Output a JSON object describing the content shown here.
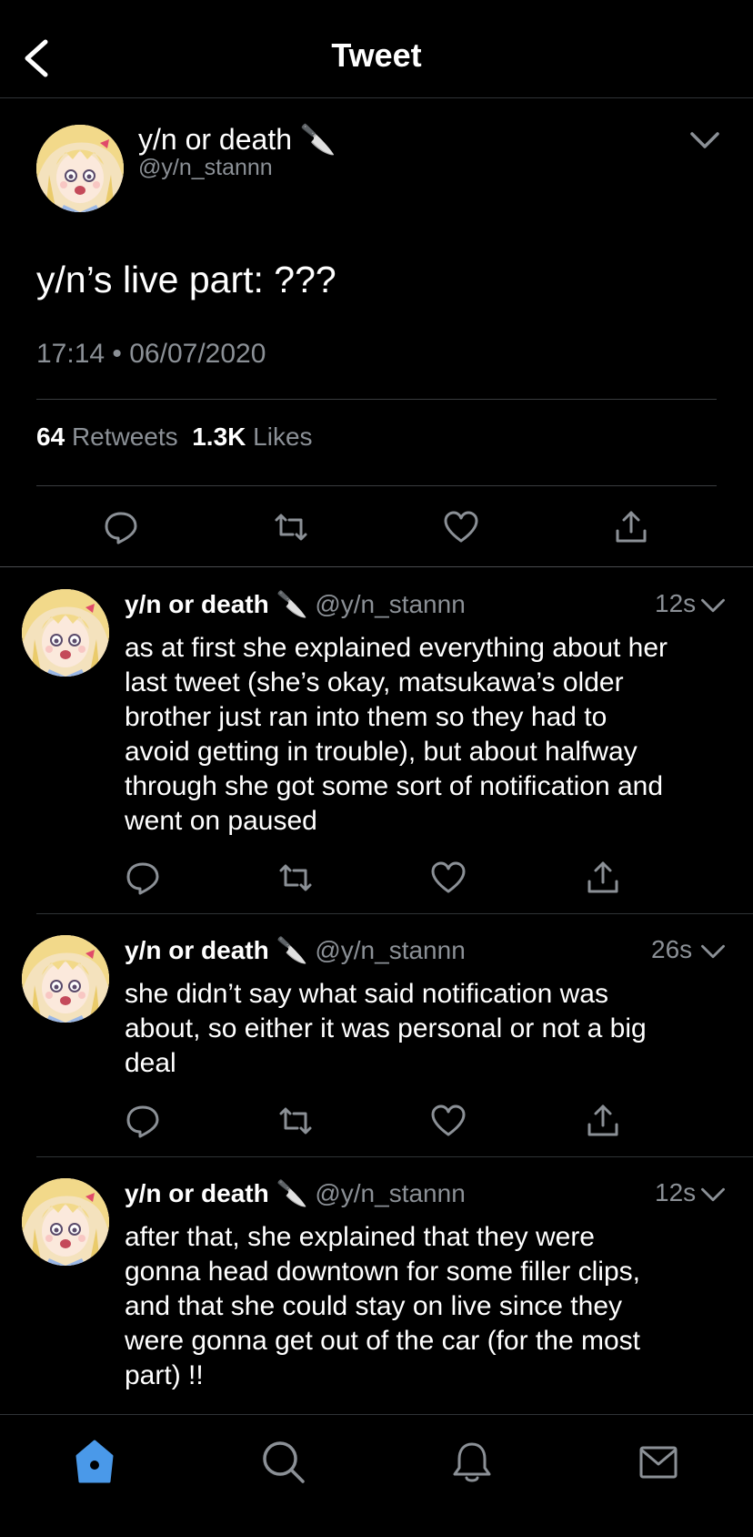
{
  "header": {
    "title": "Tweet"
  },
  "main_tweet": {
    "name": "y/n or death 🔪",
    "handle": "@y/n_stannn",
    "text": "y/n’s live part: ???",
    "timestamp": "17:14 • 06/07/2020",
    "retweets_count": "64",
    "retweets_label": "Retweets",
    "likes_count": "1.3K",
    "likes_label": "Likes"
  },
  "replies": [
    {
      "name": "y/n or death 🔪",
      "handle": "@y/n_stannn",
      "time": "12s",
      "lines": [
        "as at first she explained everything about her",
        "last tweet (she’s okay, matsukawa’s older",
        "brother just ran into them so they had to",
        "avoid getting in trouble), but about halfway",
        "through she got some sort of notification and",
        "went on paused"
      ]
    },
    {
      "name": "y/n or death 🔪",
      "handle": "@y/n_stannn",
      "time": "26s",
      "lines": [
        "she didn’t say what said notification was",
        "about, so either it was personal or not a big",
        "deal"
      ]
    },
    {
      "name": "y/n or death 🔪",
      "handle": "@y/n_stannn",
      "time": "12s",
      "lines": [
        "after that, she explained that they were",
        "gonna head downtown for some filler clips,",
        "and that she could stay on live since they",
        "were gonna get out of the car (for the most",
        "part) !!"
      ]
    }
  ],
  "tabbar": {
    "active": "home",
    "accent": "#4a99e9"
  },
  "icons": [
    "back-arrow-icon",
    "chevron-down-icon",
    "reply-icon",
    "retweet-icon",
    "like-icon",
    "share-icon",
    "home-icon",
    "search-icon",
    "notifications-icon",
    "messages-icon"
  ]
}
